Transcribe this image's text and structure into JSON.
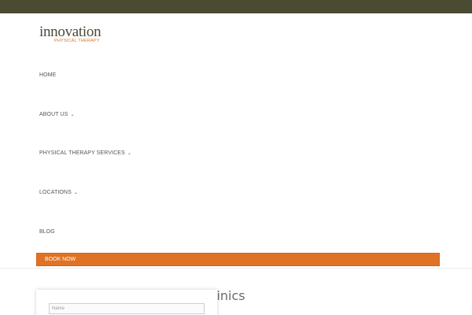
{
  "header": {
    "logo_main": "innovation",
    "logo_sub": "PHYSICAL THERAPY"
  },
  "nav": {
    "items": [
      {
        "label": "HOME",
        "has_dropdown": false
      },
      {
        "label": "ABOUT US",
        "has_dropdown": true
      },
      {
        "label": "PHYSICAL THERAPY SERVICES",
        "has_dropdown": true
      },
      {
        "label": "LOCATIONS",
        "has_dropdown": true
      },
      {
        "label": "BLOG",
        "has_dropdown": false
      }
    ],
    "dropdown_icon": "chevron-down-icon",
    "book_now_label": "BOOK NOW"
  },
  "main": {
    "heading_fragment": "linics",
    "form": {
      "name_placeholder": "Name"
    }
  },
  "colors": {
    "top_bar": "#4b4a32",
    "accent": "#e07224",
    "logo_text": "#4a4939"
  }
}
